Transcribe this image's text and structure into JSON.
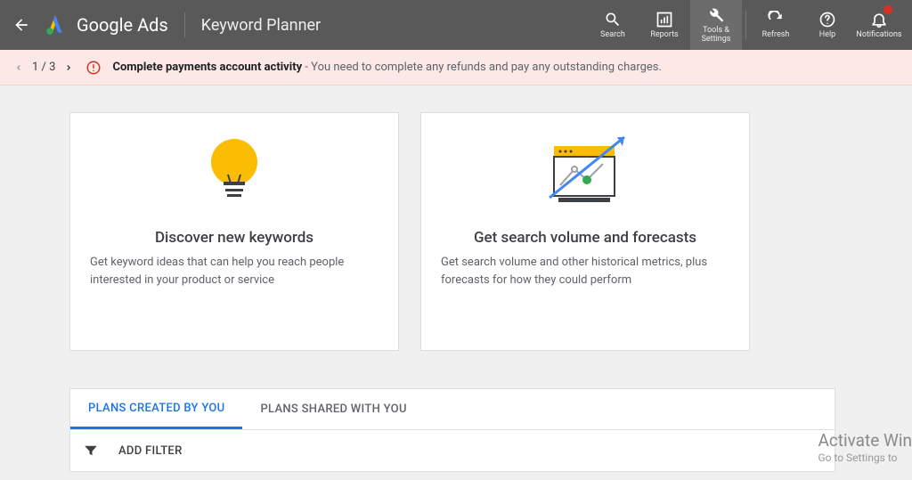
{
  "header": {
    "brand": "Google Ads",
    "page_title": "Keyword Planner",
    "nav": {
      "search": "Search",
      "reports": "Reports",
      "tools": "Tools & Settings",
      "refresh": "Refresh",
      "help": "Help",
      "notifications": "Notifications"
    }
  },
  "alert": {
    "position": "1 / 3",
    "title": "Complete payments account activity",
    "tail": " - You need to complete any refunds and pay any outstanding charges."
  },
  "cards": {
    "discover": {
      "title": "Discover new keywords",
      "desc": "Get keyword ideas that can help you reach people interested in your product or service"
    },
    "volume": {
      "title": "Get search volume and forecasts",
      "desc": "Get search volume and other historical metrics, plus forecasts for how they could perform"
    }
  },
  "plans": {
    "tab_created": "PLANS CREATED BY YOU",
    "tab_shared": "PLANS SHARED WITH YOU",
    "add_filter": "ADD FILTER"
  },
  "watermark": {
    "line1": "Activate Win",
    "line2": "Go to Settings to"
  }
}
